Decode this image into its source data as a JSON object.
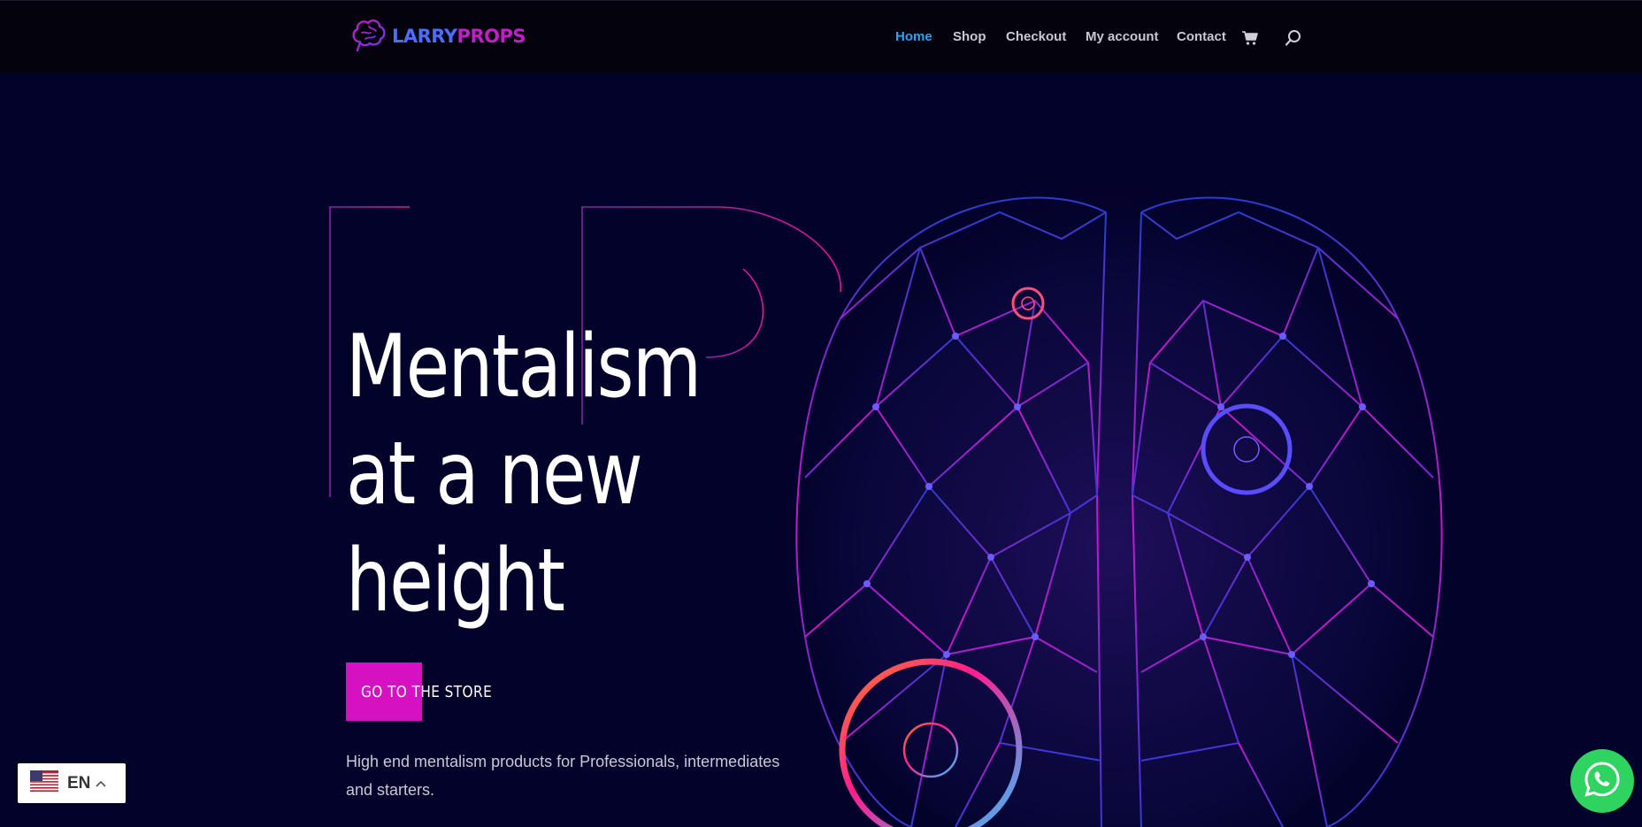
{
  "header": {
    "logo": {
      "text_part1": "LARRY",
      "text_part2": "PROPS",
      "icon": "brain-icon"
    },
    "nav": [
      {
        "label": "Home",
        "active": true
      },
      {
        "label": "Shop",
        "active": false
      },
      {
        "label": "Checkout",
        "active": false
      },
      {
        "label": "My account",
        "active": false
      },
      {
        "label": "Contact",
        "active": false
      }
    ],
    "cart_icon": "cart-icon",
    "search_icon": "search-icon"
  },
  "hero": {
    "headline": [
      "Mentalism",
      "at a new",
      "height"
    ],
    "cta_label": "GO TO THE STORE",
    "subtitle": "High end mentalism products for Professionals, intermediates and starters."
  },
  "language": {
    "code": "EN",
    "flag": "us-flag-icon"
  },
  "whatsapp_icon": "whatsapp-icon",
  "colors": {
    "background": "#03022a",
    "header_bg": "#03020d",
    "accent_magenta": "#d511c1",
    "active_nav": "#2ea3f2",
    "logo_blue": "#4c6dff",
    "logo_magenta": "#c01fc6",
    "whatsapp_green": "#2ed45f"
  }
}
